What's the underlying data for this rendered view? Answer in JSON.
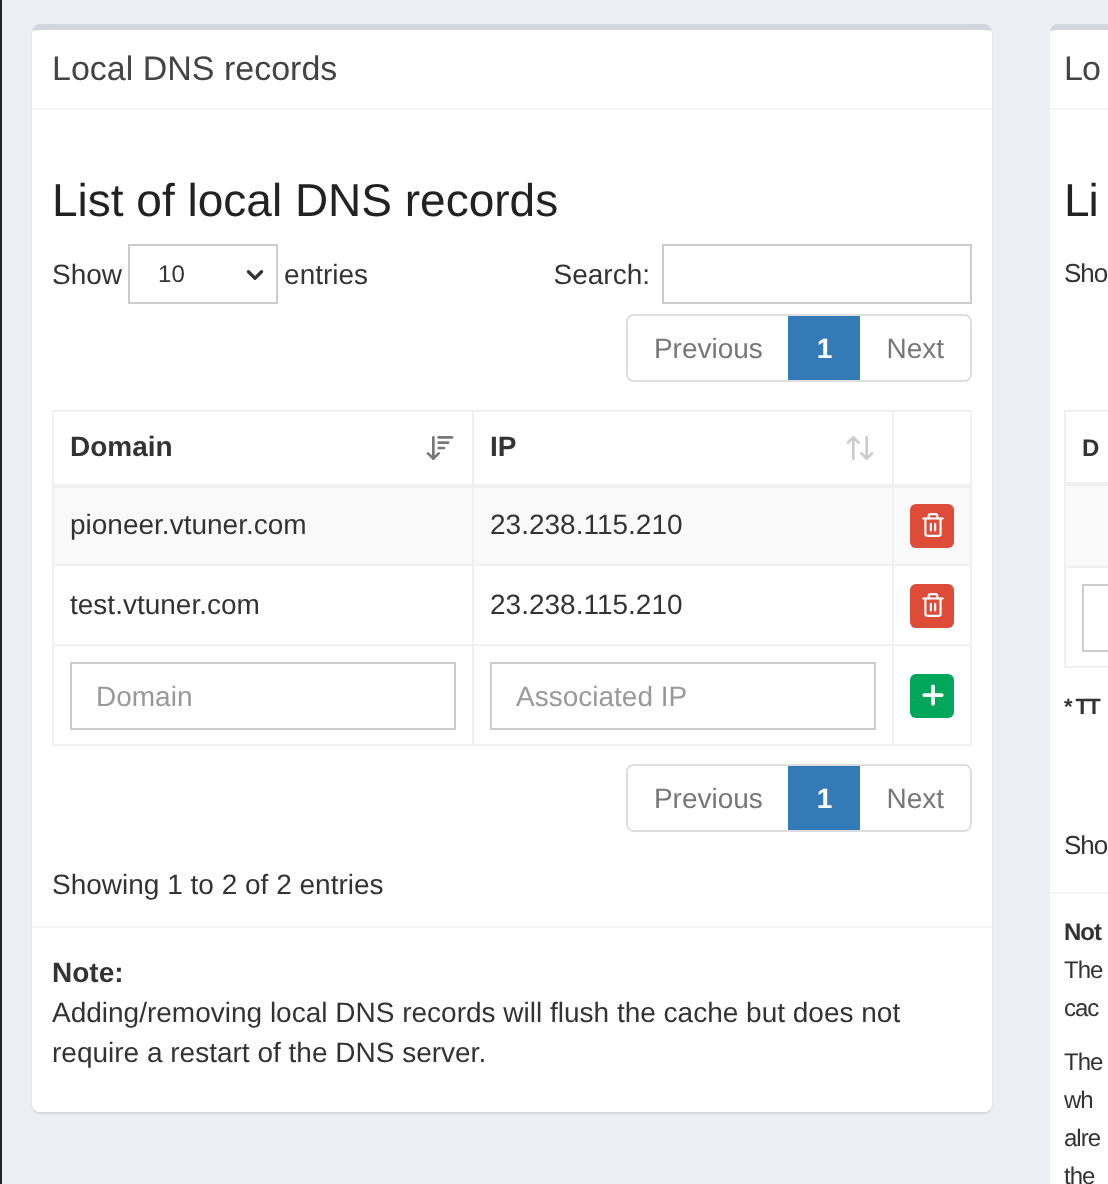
{
  "panels": [
    {
      "title": "Local DNS records",
      "heading": "List of local DNS records",
      "length": {
        "label_before": "Show",
        "value": "10",
        "label_after": "entries"
      },
      "search": {
        "label": "Search:"
      },
      "pagination_top": [
        {
          "label": "Previous",
          "selected": false
        },
        {
          "label": "1",
          "selected": true
        },
        {
          "label": "Next",
          "selected": false
        }
      ],
      "table": {
        "columns": [
          {
            "label": "Domain",
            "sorted": true
          },
          {
            "label": "IP",
            "sorted": false
          }
        ],
        "rows": [
          {
            "domain": "pioneer.vtuner.com",
            "ip": "23.238.115.210"
          },
          {
            "domain": "test.vtuner.com",
            "ip": "23.238.115.210"
          }
        ],
        "new_row": {
          "domain_placeholder": "Domain",
          "ip_placeholder": "Associated IP"
        }
      },
      "pagination_bottom": [
        {
          "label": "Previous",
          "selected": false
        },
        {
          "label": "1",
          "selected": true
        },
        {
          "label": "Next",
          "selected": false
        }
      ],
      "info": "Showing 1 to 2 of 2 entries",
      "note": {
        "title": "Note:",
        "text": "Adding/removing local DNS records will flush the cache but does not require a restart of the DNS server."
      }
    }
  ],
  "second_panel": {
    "title": "Lo",
    "heading": "Li",
    "show_label": "Sho",
    "column": "D",
    "footnote": "* TT",
    "info": "Sho",
    "note_title": "Not",
    "note_paragraphs": [
      [
        "The",
        "cac"
      ],
      [
        "The",
        "wh",
        "alre",
        "the"
      ]
    ]
  }
}
